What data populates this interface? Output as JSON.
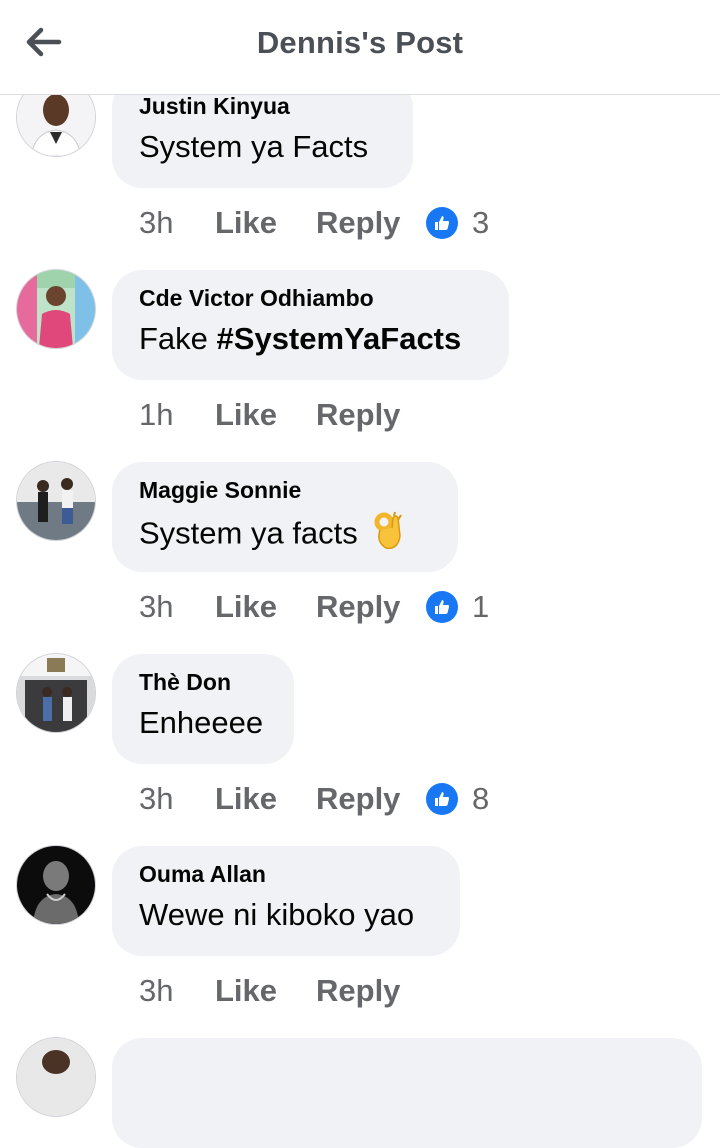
{
  "header": {
    "title": "Dennis's Post",
    "back_icon": "arrow-left-icon"
  },
  "comments": [
    {
      "author": "Justin Kinyua",
      "text": "System ya Facts",
      "time": "3h",
      "like": "Like",
      "reply": "Reply",
      "reactions": "3"
    },
    {
      "author": "Cde Victor Odhiambo",
      "text_prefix": "Fake ",
      "hashtag": "#SystemYaFacts",
      "time": "1h",
      "like": "Like",
      "reply": "Reply"
    },
    {
      "author": "Maggie Sonnie",
      "text": "System ya facts",
      "emoji": "ok-hand-emoji",
      "time": "3h",
      "like": "Like",
      "reply": "Reply",
      "reactions": "1"
    },
    {
      "author": "Thè Don",
      "text": "Enheeee",
      "time": "3h",
      "like": "Like",
      "reply": "Reply",
      "reactions": "8"
    },
    {
      "author": "Ouma Allan",
      "text": "Wewe ni kiboko yao",
      "time": "3h",
      "like": "Like",
      "reply": "Reply"
    }
  ],
  "colors": {
    "accent": "#1877f2",
    "bubble": "#f0f2f5",
    "meta": "#65676b"
  }
}
